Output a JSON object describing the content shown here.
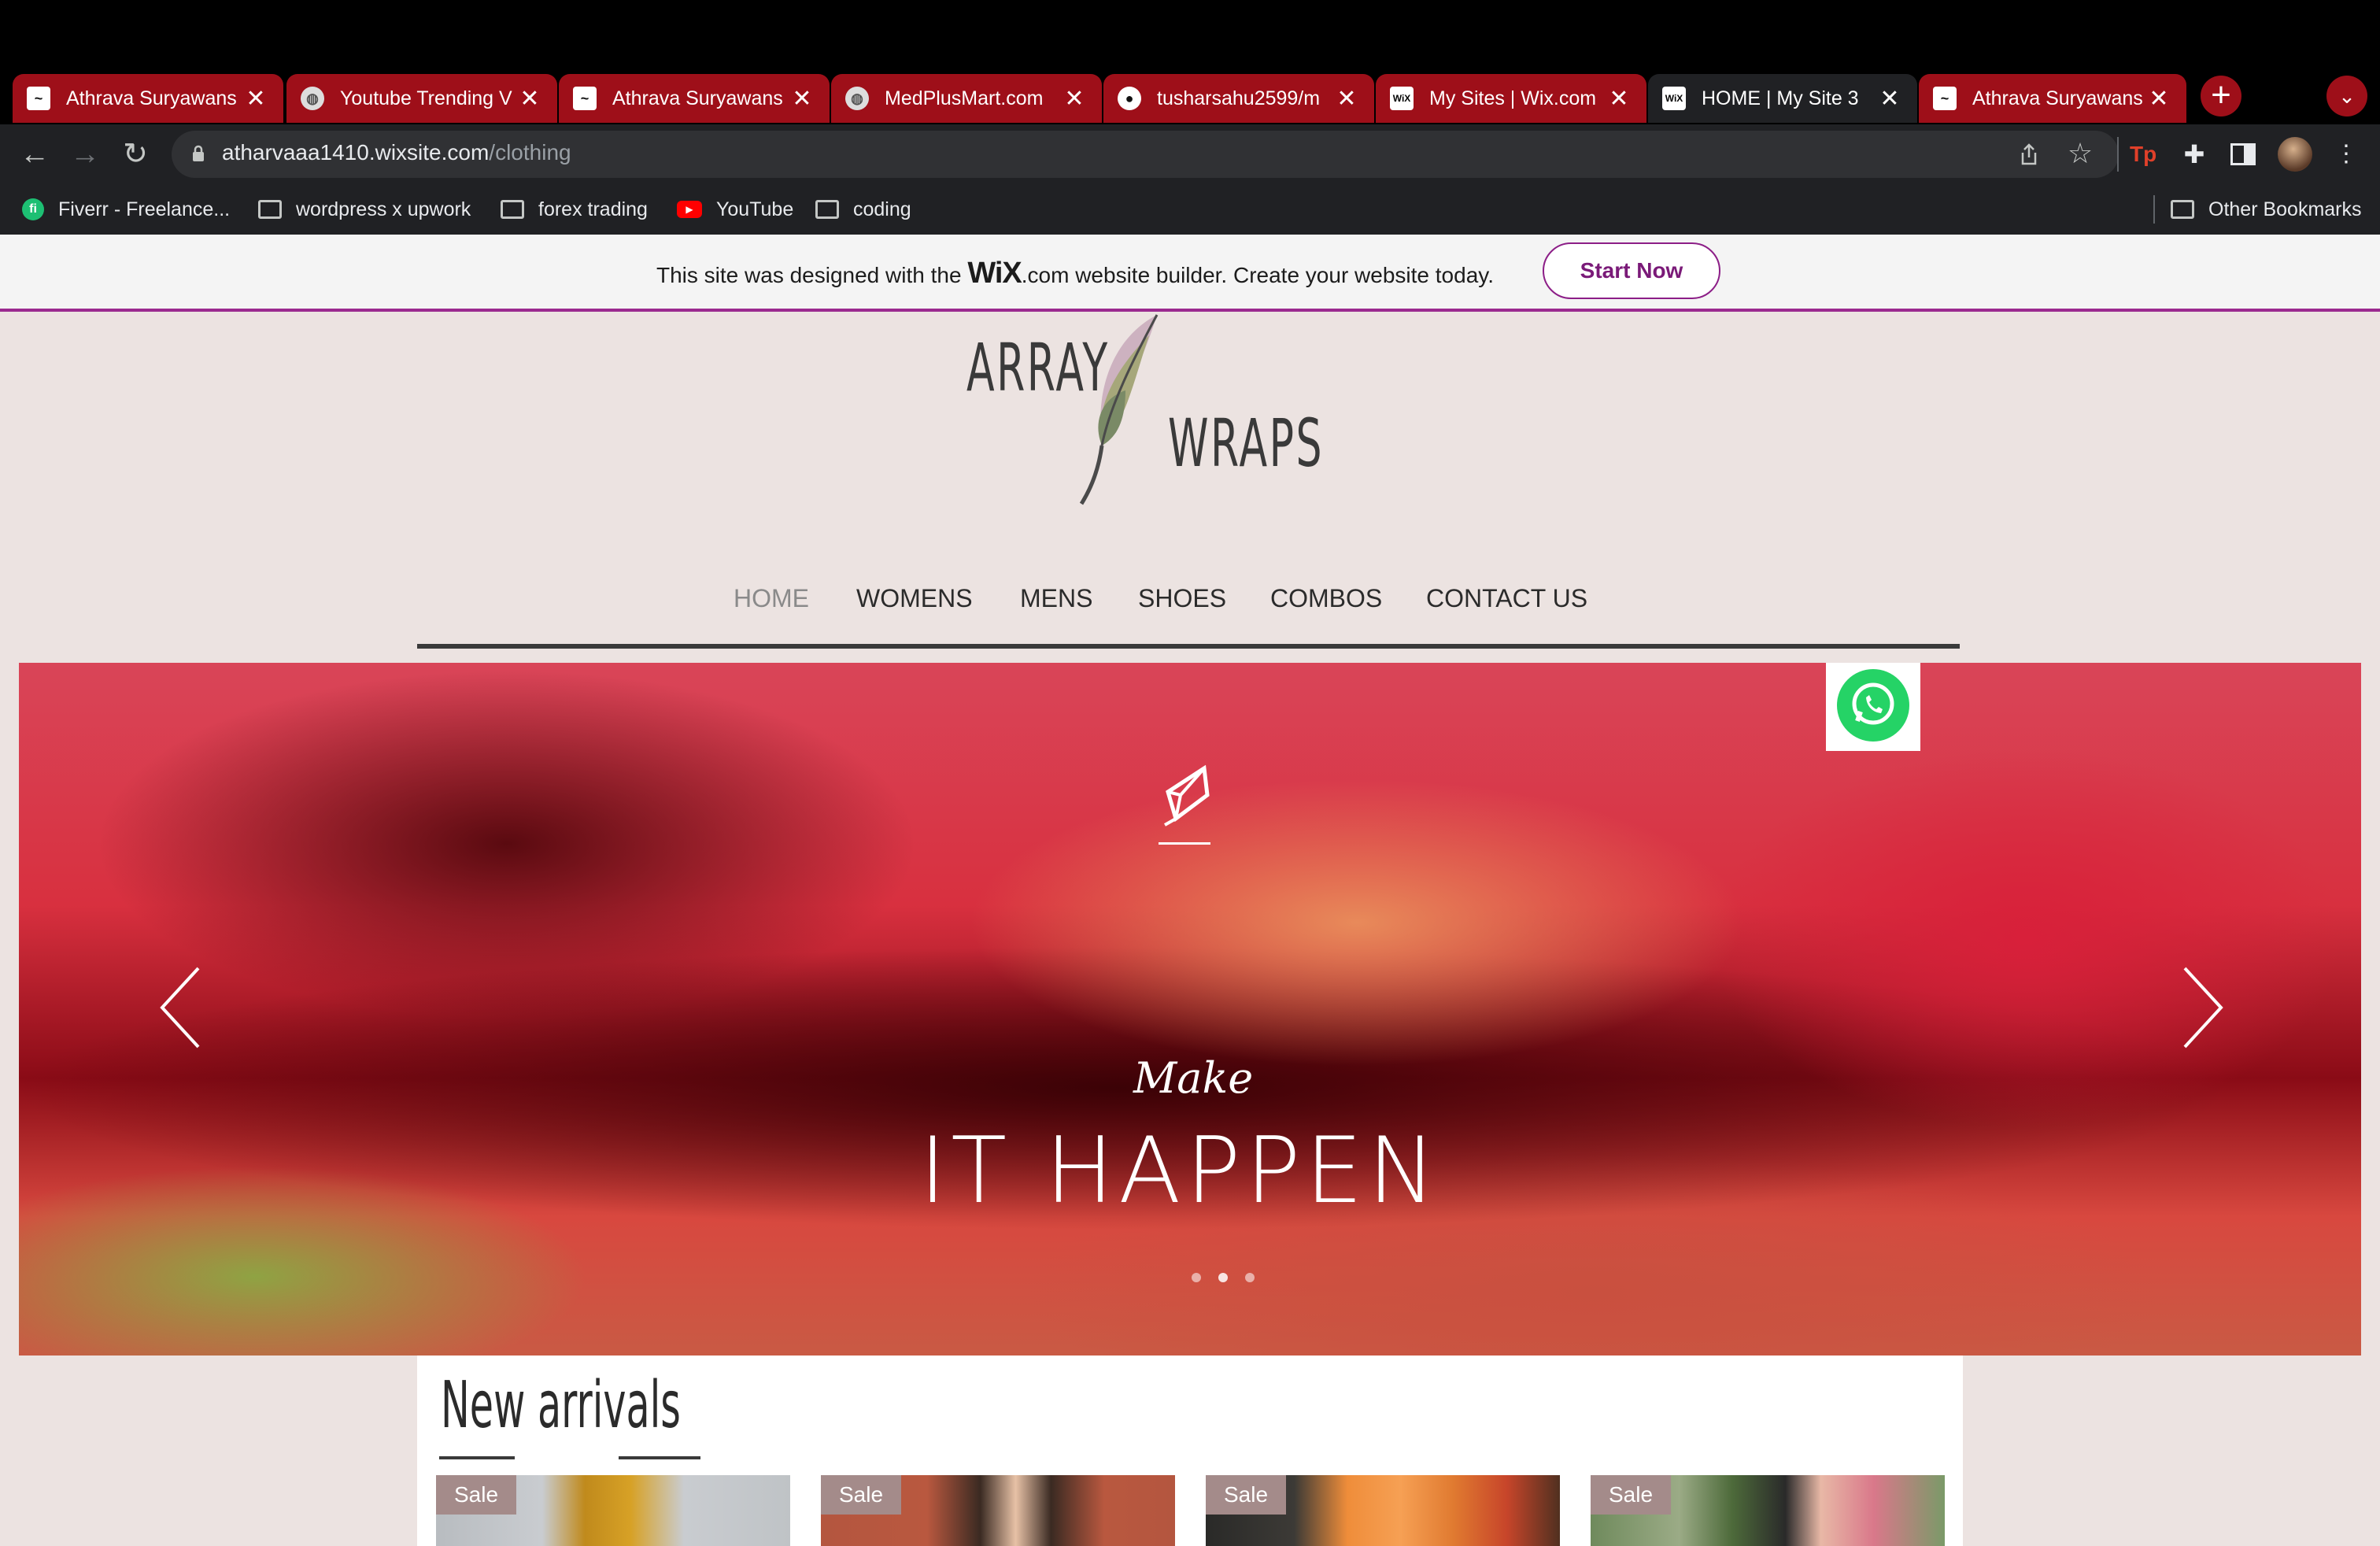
{
  "browser": {
    "tabs": [
      {
        "title": "Athrava Suryawans",
        "favicon": "site-favicon",
        "active": false
      },
      {
        "title": "Youtube Trending V",
        "favicon": "globe-icon",
        "active": false
      },
      {
        "title": "Athrava Suryawans",
        "favicon": "site-favicon",
        "active": false
      },
      {
        "title": "MedPlusMart.com",
        "favicon": "globe-icon",
        "active": false
      },
      {
        "title": "tusharsahu2599/m",
        "favicon": "github-icon",
        "active": false
      },
      {
        "title": "My Sites | Wix.com",
        "favicon": "wix-icon",
        "active": false
      },
      {
        "title": "HOME | My Site 3",
        "favicon": "wix-icon",
        "active": true
      },
      {
        "title": "Athrava Suryawans",
        "favicon": "site-favicon",
        "active": false
      }
    ],
    "url": {
      "host": "atharvaaa1410.wixsite.com",
      "path": "/clothing"
    },
    "bookmarks": [
      {
        "label": "Fiverr - Freelance...",
        "icon": "fiverr-icon"
      },
      {
        "label": "wordpress x upwork",
        "icon": "folder-icon"
      },
      {
        "label": "forex trading",
        "icon": "folder-icon"
      },
      {
        "label": "YouTube",
        "icon": "youtube-icon"
      },
      {
        "label": "coding",
        "icon": "folder-icon"
      }
    ],
    "other_bookmarks": "Other Bookmarks",
    "colors": {
      "tab_bg": "#9e0f19",
      "toolbar": "#202124"
    }
  },
  "wix_banner": {
    "text_before": "This site was designed with the ",
    "logo": "WiX",
    "text_after": ".com website builder. Create your website today.",
    "button": "Start Now",
    "accent": "#9b2a8f"
  },
  "site": {
    "logo_line1": "ARRAY",
    "logo_line2": "WRAPS",
    "menu": [
      "HOME",
      "WOMENS",
      "MENS",
      "SHOES",
      "COMBOS",
      "CONTACT US"
    ],
    "current_menu": "HOME",
    "hero": {
      "script": "Make",
      "headline": "IT HAPPEN",
      "slides": 3
    },
    "section_title": "New arrivals",
    "products": [
      {
        "badge": "Sale"
      },
      {
        "badge": "Sale"
      },
      {
        "badge": "Sale"
      },
      {
        "badge": "Sale"
      }
    ]
  }
}
